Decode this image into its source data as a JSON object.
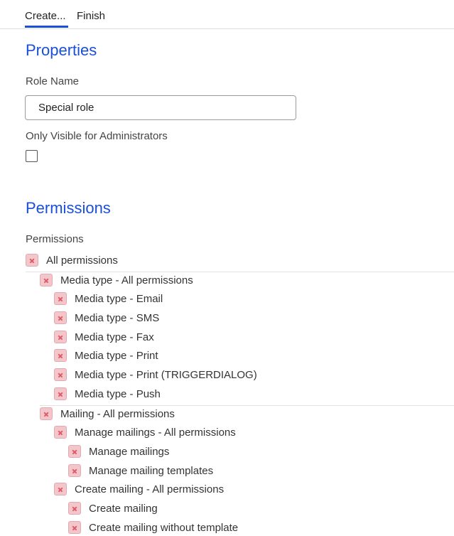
{
  "tabs": [
    {
      "label": "Create..."
    },
    {
      "label": "Finish"
    }
  ],
  "properties": {
    "heading": "Properties",
    "role_name_label": "Role Name",
    "role_name_value": "Special role",
    "admin_only_label": "Only Visible for Administrators",
    "admin_only_checked": false
  },
  "permissions": {
    "heading": "Permissions",
    "field_label": "Permissions",
    "items": [
      {
        "label": "All permissions",
        "level": 0,
        "state": "denied"
      },
      {
        "label": "Media type - All permissions",
        "level": 1,
        "state": "denied"
      },
      {
        "label": "Media type - Email",
        "level": 2,
        "state": "denied"
      },
      {
        "label": "Media type - SMS",
        "level": 2,
        "state": "denied"
      },
      {
        "label": "Media type - Fax",
        "level": 2,
        "state": "denied"
      },
      {
        "label": "Media type - Print",
        "level": 2,
        "state": "denied"
      },
      {
        "label": "Media type - Print (TRIGGERDIALOG)",
        "level": 2,
        "state": "denied"
      },
      {
        "label": "Media type - Push",
        "level": 2,
        "state": "denied"
      },
      {
        "label": "Mailing - All permissions",
        "level": 1,
        "state": "denied"
      },
      {
        "label": "Manage mailings - All permissions",
        "level": 2,
        "state": "denied"
      },
      {
        "label": "Manage mailings",
        "level": 3,
        "state": "denied"
      },
      {
        "label": "Manage mailing templates",
        "level": 3,
        "state": "denied"
      },
      {
        "label": "Create mailing - All permissions",
        "level": 2,
        "state": "denied"
      },
      {
        "label": "Create mailing",
        "level": 3,
        "state": "denied"
      },
      {
        "label": "Create mailing without template",
        "level": 3,
        "state": "denied"
      }
    ]
  },
  "colors": {
    "accent": "#1a4fd6",
    "denied_bg": "#f2c6ca",
    "denied_x": "#e05b66"
  },
  "icons": {
    "denied": "x-mark-icon"
  }
}
